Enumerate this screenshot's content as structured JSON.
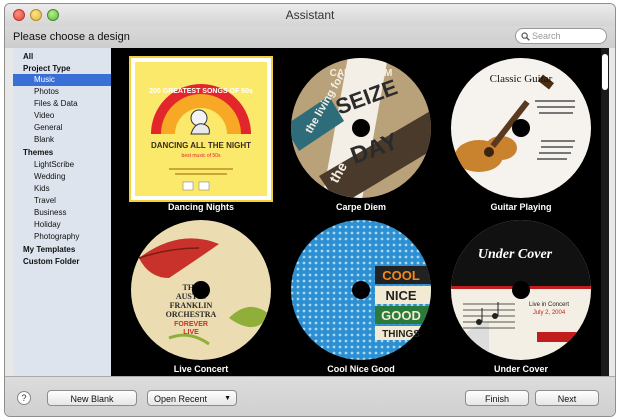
{
  "window": {
    "title": "Assistant"
  },
  "toolbar": {
    "prompt": "Please choose a design",
    "search_placeholder": "Search"
  },
  "sidebar": {
    "all": "All",
    "project_type": {
      "label": "Project Type",
      "items": [
        "Music",
        "Photos",
        "Files & Data",
        "Video",
        "General",
        "Blank"
      ],
      "selected": "Music"
    },
    "themes": {
      "label": "Themes",
      "items": [
        "LightScribe",
        "Wedding",
        "Kids",
        "Travel",
        "Business",
        "Holiday",
        "Photography"
      ]
    },
    "my_templates": "My Templates",
    "custom_folder": "Custom Folder"
  },
  "designs": [
    {
      "name": "Dancing Nights",
      "selected": true,
      "texts": {
        "banner": "200 GREATEST SONGS OF 50s",
        "headline": "DANCING ALL THE NIGHT",
        "sub": "best music of 50s"
      }
    },
    {
      "name": "Carpe Diem",
      "texts": {
        "big1": "SEIZE",
        "big2": "DAY",
        "side": "CARPE DIEM",
        "curve": "the living for",
        "label": "the"
      }
    },
    {
      "name": "Guitar Playing",
      "texts": {
        "title": "Classic Guitar"
      }
    },
    {
      "name": "Live Concert",
      "texts": {
        "line1": "THE",
        "line2": "AUSTIN",
        "line3": "FRANKLIN",
        "line4": "ORCHESTRA",
        "line5": "FOREVER",
        "line6": "LIVE"
      }
    },
    {
      "name": "Cool Nice Good",
      "texts": {
        "w1": "COOL",
        "w2": "NICE",
        "w3": "GOOD",
        "w4": "THINGS"
      }
    },
    {
      "name": "Under Cover",
      "texts": {
        "title": "Under Cover",
        "sub": "Live in Concert",
        "date": "July 2, 2004"
      }
    }
  ],
  "buttons": {
    "help": "?",
    "new_blank": "New Blank",
    "open_recent": "Open Recent",
    "finish": "Finish",
    "next": "Next"
  },
  "colors": {
    "selection": "#3a6fd6",
    "sidebar_bg": "#dde4ed",
    "grid_bg": "#000000"
  }
}
